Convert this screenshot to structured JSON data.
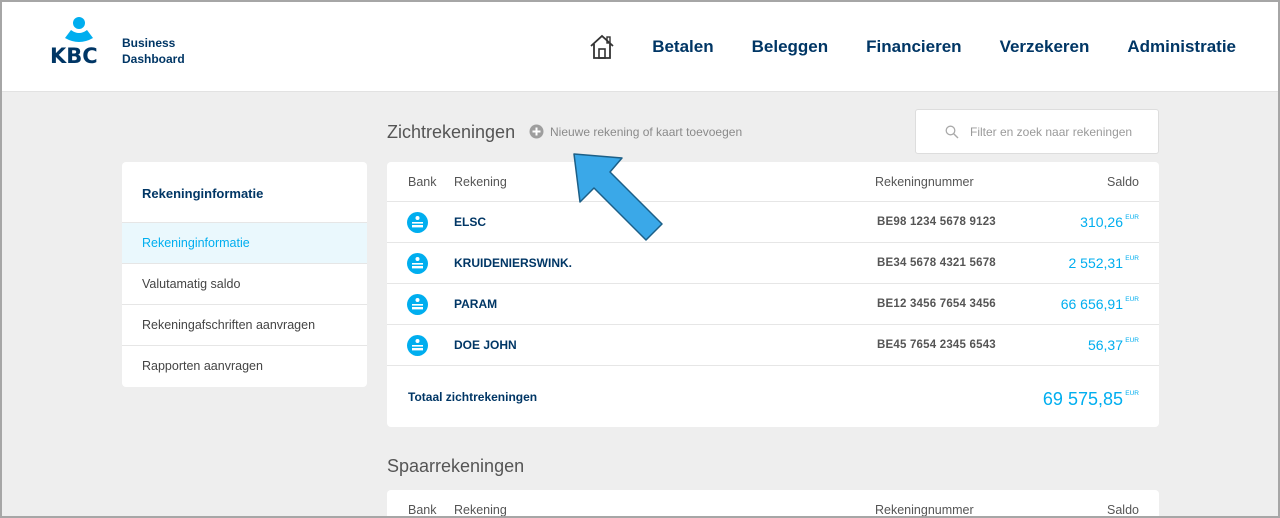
{
  "header": {
    "brand_line1": "Business",
    "brand_line2": "Dashboard",
    "nav": [
      "Betalen",
      "Beleggen",
      "Financieren",
      "Verzekeren",
      "Administratie"
    ]
  },
  "sidebar": {
    "title": "Rekeninginformatie",
    "items": [
      {
        "label": "Rekeninginformatie",
        "active": true
      },
      {
        "label": "Valutamatig saldo",
        "active": false
      },
      {
        "label": "Rekeningafschriften aanvragen",
        "active": false
      },
      {
        "label": "Rapporten aanvragen",
        "active": false
      }
    ]
  },
  "zicht": {
    "title": "Zichtrekeningen",
    "add_label": "Nieuwe rekening of kaart toevoegen",
    "columns": {
      "bank": "Bank",
      "name": "Rekening",
      "number": "Rekeningnummer",
      "saldo": "Saldo"
    },
    "rows": [
      {
        "name": "ELSC",
        "number": "BE98 1234 5678 9123",
        "amount": "310,26",
        "currency": "EUR"
      },
      {
        "name": "KRUIDENIERSWINK.",
        "number": "BE34 5678 4321 5678",
        "amount": "2 552,31",
        "currency": "EUR"
      },
      {
        "name": "PARAM",
        "number": "BE12 3456 7654 3456",
        "amount": "66 656,91",
        "currency": "EUR"
      },
      {
        "name": "DOE JOHN",
        "number": "BE45 7654 2345 6543",
        "amount": "56,37",
        "currency": "EUR"
      }
    ],
    "total_label": "Totaal zichtrekeningen",
    "total_amount": "69 575,85",
    "total_currency": "EUR"
  },
  "search": {
    "placeholder": "Filter en zoek naar rekeningen"
  },
  "spaar": {
    "title": "Spaarrekeningen",
    "columns": {
      "bank": "Bank",
      "name": "Rekening",
      "number": "Rekeningnummer",
      "saldo": "Saldo"
    }
  },
  "colors": {
    "accent": "#00aeef",
    "navy": "#003665",
    "arrow": "#3aa8e8"
  },
  "icons": {
    "home": "home-icon",
    "add": "plus-circle-icon",
    "search": "search-icon",
    "bank": "kbc-bank-icon"
  }
}
